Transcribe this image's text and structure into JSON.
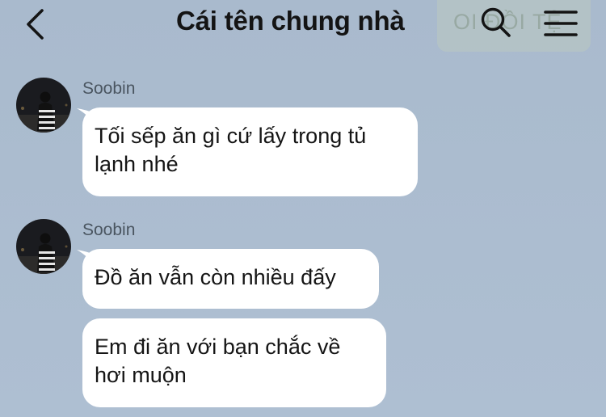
{
  "header": {
    "title": "Cái tên chung nhà",
    "ghost_text": "OI ĐỒI TỆ"
  },
  "messages": [
    {
      "sender": "Soobin",
      "bubbles": [
        {
          "text": "Tối sếp ăn gì cứ lấy trong tủ\nlạnh nhé"
        }
      ]
    },
    {
      "sender": "Soobin",
      "bubbles": [
        {
          "text": "Đồ ăn vẫn còn nhiều đấy"
        },
        {
          "text": "Em đi ăn với bạn chắc về\nhơi muộn"
        }
      ]
    }
  ],
  "colors": {
    "background": "#a9bacd",
    "bubble": "#ffffff",
    "title": "#141414",
    "sender": "#4a5560"
  },
  "icons": {
    "back": "chevron-left-icon",
    "search": "search-icon",
    "menu": "hamburger-menu-icon"
  }
}
